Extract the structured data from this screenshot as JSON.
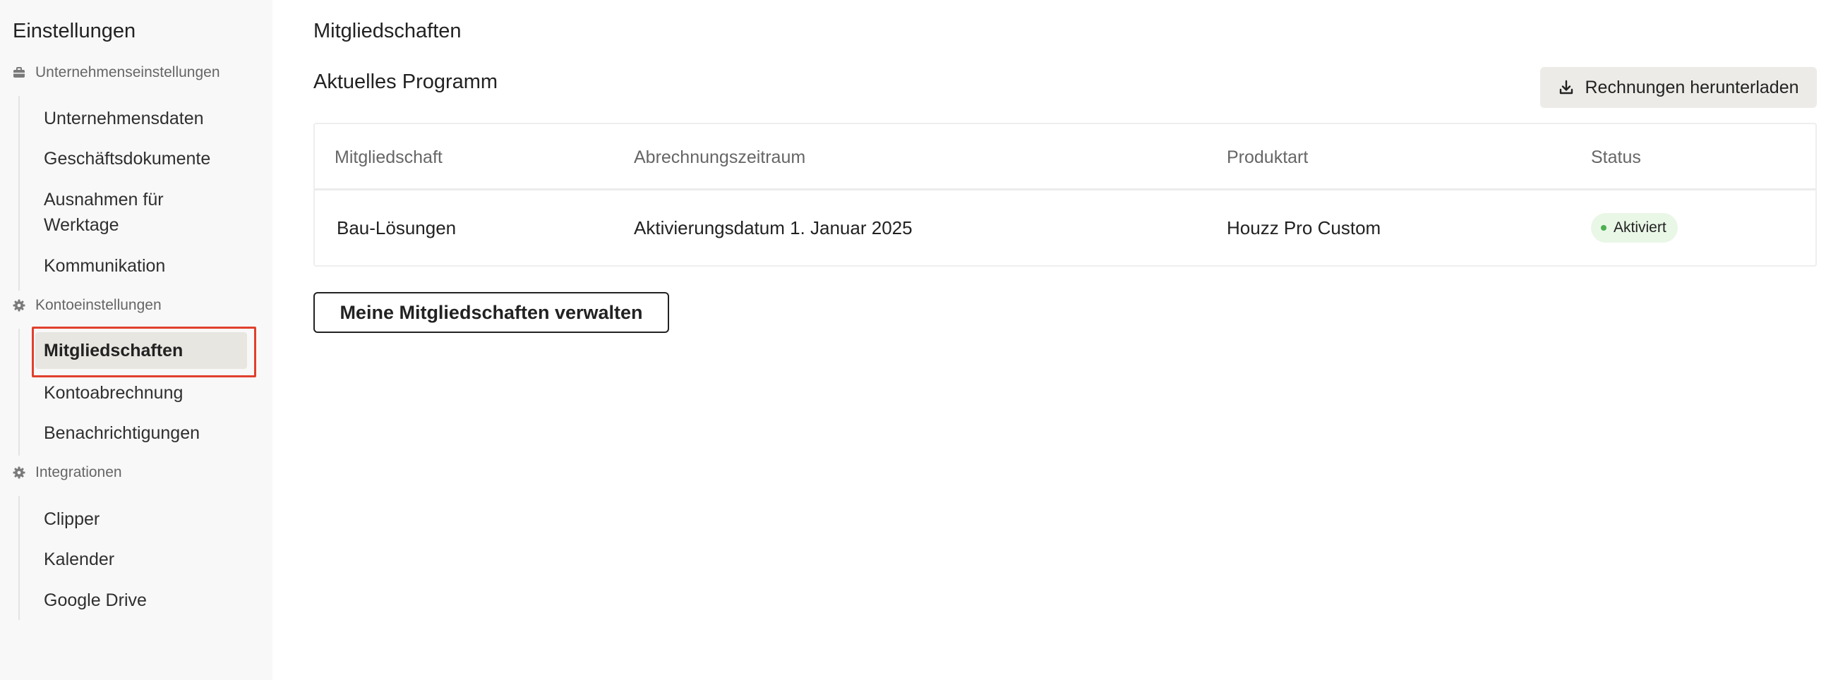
{
  "sidebar": {
    "title": "Einstellungen",
    "groups": [
      {
        "label": "Unternehmenseinstellungen",
        "icon": "briefcase-icon",
        "items": [
          {
            "label": "Unternehmensdaten"
          },
          {
            "label": "Geschäftsdokumente"
          },
          {
            "label": "Ausnahmen für Werktage"
          },
          {
            "label": "Kommunikation"
          }
        ]
      },
      {
        "label": "Kontoeinstellungen",
        "icon": "gear-icon",
        "items": [
          {
            "label": "Mitgliedschaften",
            "active": true
          },
          {
            "label": "Kontoabrechnung"
          },
          {
            "label": "Benachrichtigungen"
          }
        ]
      },
      {
        "label": "Integrationen",
        "icon": "gear-icon",
        "items": [
          {
            "label": "Clipper"
          },
          {
            "label": "Kalender"
          },
          {
            "label": "Google Drive"
          }
        ]
      }
    ]
  },
  "main": {
    "page_title": "Mitgliedschaften",
    "section_title": "Aktuelles Programm",
    "download_button": {
      "label": "Rechnungen herunterladen",
      "icon": "download-icon"
    },
    "table": {
      "columns": [
        "Mitgliedschaft",
        "Abrechnungszeitraum",
        "Produktart",
        "Status"
      ],
      "rows": [
        {
          "membership": "Bau-Lösungen",
          "billing_period": "Aktivierungsdatum 1. Januar 2025",
          "product_type": "Houzz Pro Custom",
          "status": "Aktiviert"
        }
      ]
    },
    "manage_button": {
      "label": "Meine Mitgliedschaften verwalten"
    }
  },
  "colors": {
    "sidebar_bg": "#f8f8f8",
    "active_item_bg": "#e8e6e1",
    "focus_outline": "#e0402c",
    "status_badge_bg": "#e9f7e6",
    "status_dot": "#4caf50",
    "download_button_bg": "#ecebe7"
  }
}
